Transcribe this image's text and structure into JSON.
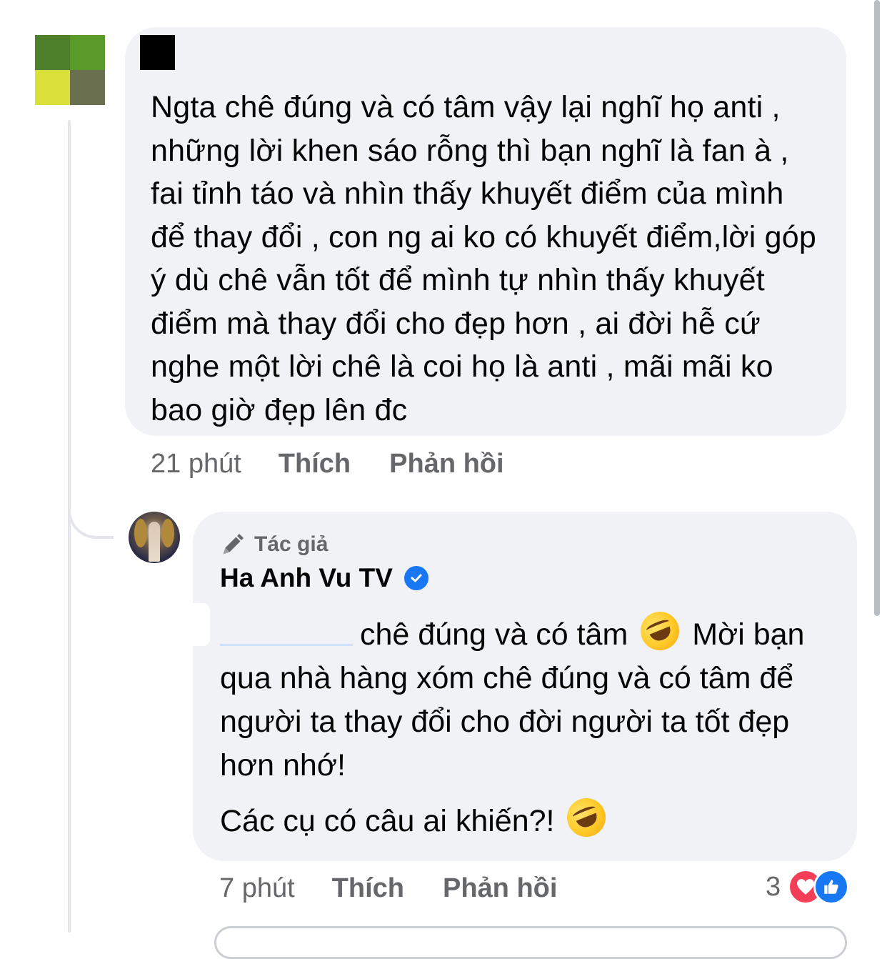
{
  "comment": {
    "avatar_colors": [
      "#4e7f2a",
      "#5a9a2b",
      "#d9e03a",
      "#6a6f4f"
    ],
    "text": "Ngta chê đúng và có tâm vậy lại nghĩ họ anti , những lời khen sáo rỗng thì bạn nghĩ là fan à , fai tỉnh táo và nhìn thấy khuyết điểm của mình để thay đổi , con ng ai ko có khuyết điểm,lời góp ý dù chê vẫn tốt để mình tự nhìn thấy khuyết điểm mà thay đổi cho đẹp hơn , ai đời hễ cứ nghe một lời chê là coi họ là anti , mãi mãi ko bao giờ đẹp lên đc",
    "time": "21 phút",
    "like_label": "Thích",
    "reply_label": "Phản hồi"
  },
  "reply": {
    "author_badge": "Tác giả",
    "author_name": "Ha Anh Vu TV",
    "text_line1_after_mention": "chê đúng và có tâm",
    "text_line1_tail": "Mời bạn qua nhà hàng xóm chê đúng và có tâm để người ta thay đổi cho đời người ta tốt đẹp hơn nhớ!",
    "text_line2": "Các cụ có câu ai khiến?!",
    "emoji_icon": "rolling-on-floor-laughing-emoji",
    "time": "7 phút",
    "like_label": "Thích",
    "reply_label": "Phản hồi",
    "reaction_count": "3",
    "reaction_icons": [
      "love-reaction",
      "like-reaction"
    ]
  },
  "colors": {
    "bubble": "#f0f2f5",
    "meta_text": "#65676b",
    "verified": "#1877f2",
    "love": "#f33e58",
    "like": "#1877f2"
  }
}
